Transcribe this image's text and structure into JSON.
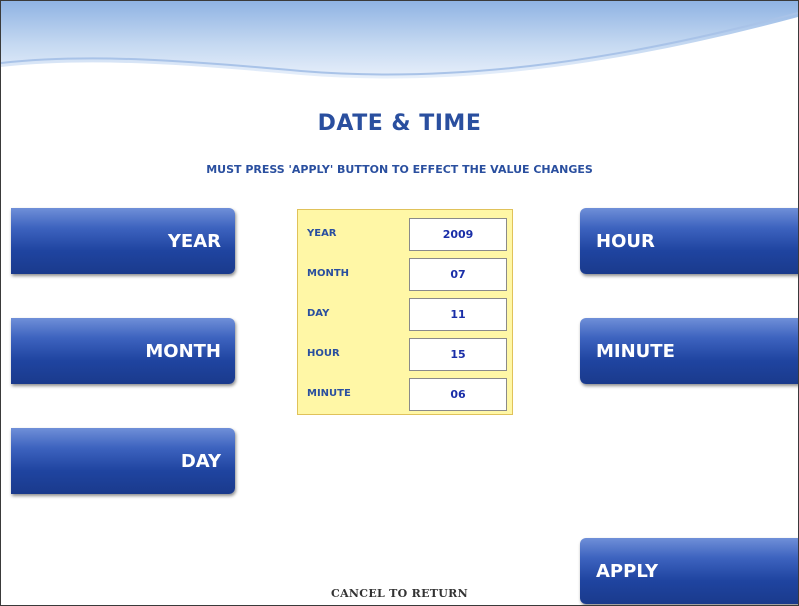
{
  "screen": {
    "title": "DATE & TIME",
    "subtitle": "MUST PRESS 'APPLY' BUTTON TO EFFECT THE VALUE CHANGES",
    "footer": "CANCEL TO RETURN"
  },
  "left_buttons": {
    "year": "YEAR",
    "month": "MONTH",
    "day": "DAY"
  },
  "right_buttons": {
    "hour": "HOUR",
    "minute": "MINUTE",
    "apply": "APPLY"
  },
  "values_panel": {
    "rows": [
      {
        "label": "YEAR",
        "value": "2009"
      },
      {
        "label": "MONTH",
        "value": "07"
      },
      {
        "label": "DAY",
        "value": "11"
      },
      {
        "label": "HOUR",
        "value": "15"
      },
      {
        "label": "MINUTE",
        "value": "06"
      }
    ]
  },
  "colors": {
    "accent_text": "#2a4f9f",
    "button_blue": "#1f44a0",
    "panel_yellow": "#fff7a6"
  }
}
